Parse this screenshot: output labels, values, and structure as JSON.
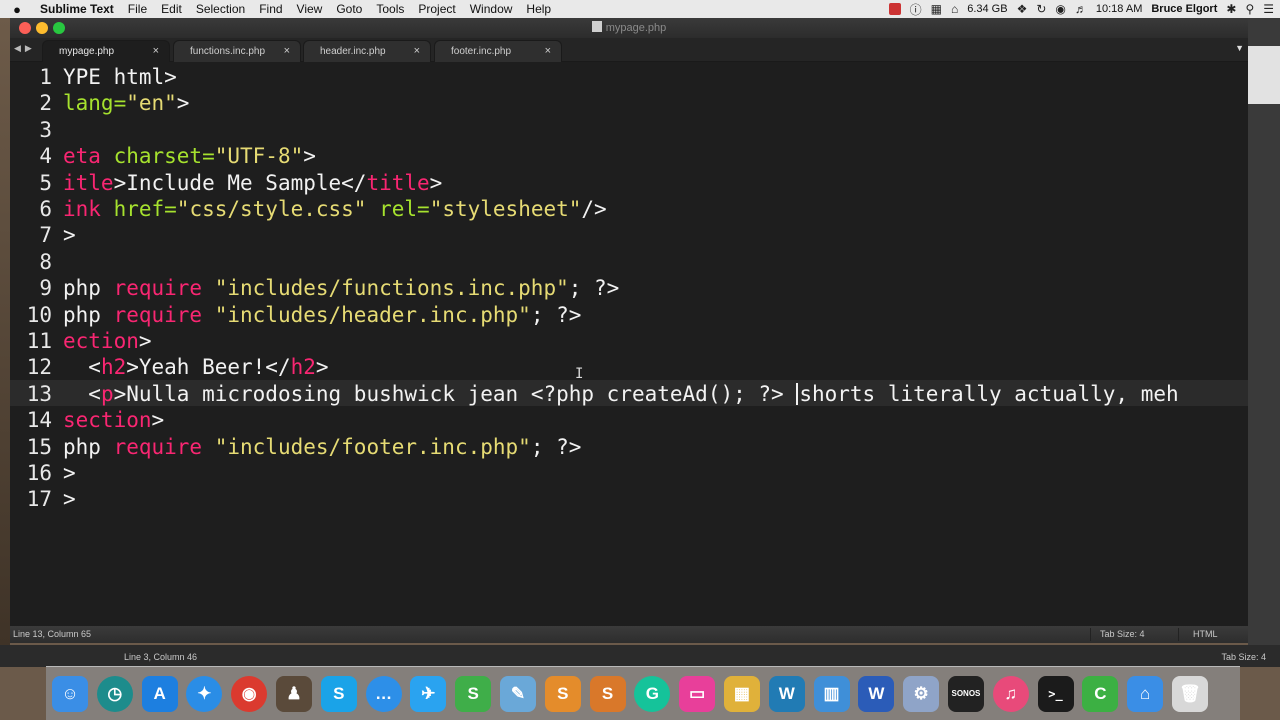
{
  "menubar": {
    "apple": "",
    "app": "Sublime Text",
    "menus": [
      "File",
      "Edit",
      "Selection",
      "Find",
      "View",
      "Goto",
      "Tools",
      "Project",
      "Window",
      "Help"
    ],
    "storage": "6.34 GB",
    "time": "10:18 AM",
    "user": "Bruce Elgort"
  },
  "window": {
    "title": "mypage.php"
  },
  "tabs": [
    {
      "label": "mypage.php",
      "close": "×"
    },
    {
      "label": "functions.inc.php",
      "close": "×"
    },
    {
      "label": "header.inc.php",
      "close": "×"
    },
    {
      "label": "footer.inc.php",
      "close": "×"
    }
  ],
  "editor": {
    "line_numbers": [
      "1",
      "2",
      "3",
      "4",
      "5",
      "6",
      "7",
      "8",
      "9",
      "10",
      "11",
      "12",
      "13",
      "14",
      "15",
      "16",
      "17"
    ],
    "current_line": 13
  },
  "statusbar": {
    "position": "Line 13, Column 65",
    "tab_size": "Tab Size: 4",
    "syntax": "HTML"
  },
  "background_window": {
    "position": "Line 3, Column 46",
    "tab_size": "Tab Size: 4"
  },
  "dock": {
    "apps": [
      {
        "name": "Finder",
        "glyph": "☺",
        "color": "#3a8ee6"
      },
      {
        "name": "Time Machine",
        "glyph": "◷",
        "color": "#1d8c8c"
      },
      {
        "name": "App Store",
        "glyph": "A",
        "color": "#1d7fe0"
      },
      {
        "name": "Safari",
        "glyph": "✦",
        "color": "#2a8de6"
      },
      {
        "name": "Chrome",
        "glyph": "◉",
        "color": "#db3a2f"
      },
      {
        "name": "Agent",
        "glyph": "♟",
        "color": "#5a4a3a"
      },
      {
        "name": "Skype",
        "glyph": "S",
        "color": "#1aa3e8"
      },
      {
        "name": "Messages",
        "glyph": "…",
        "color": "#2d8fe8"
      },
      {
        "name": "Twitter",
        "glyph": "✈",
        "color": "#2aa3f0"
      },
      {
        "name": "Snagit",
        "glyph": "S",
        "color": "#3fae49"
      },
      {
        "name": "Preview",
        "glyph": "✎",
        "color": "#6aa8d8"
      },
      {
        "name": "Sublime Text",
        "glyph": "S",
        "color": "#e48c2b"
      },
      {
        "name": "Sublime Text 2",
        "glyph": "S",
        "color": "#d9782a"
      },
      {
        "name": "Grammarly",
        "glyph": "G",
        "color": "#15c39a"
      },
      {
        "name": "Keynote Pink",
        "glyph": "▭",
        "color": "#e83f9a"
      },
      {
        "name": "Transmit",
        "glyph": "▦",
        "color": "#e0b13a"
      },
      {
        "name": "WordPress",
        "glyph": "W",
        "color": "#217bb4"
      },
      {
        "name": "Screens",
        "glyph": "▥",
        "color": "#3f8fd8"
      },
      {
        "name": "Word",
        "glyph": "W",
        "color": "#2b5cb8"
      },
      {
        "name": "Utility",
        "glyph": "⚙",
        "color": "#8fa4c8"
      },
      {
        "name": "Sonos",
        "glyph": "SONOS",
        "color": "#222222"
      },
      {
        "name": "iTunes",
        "glyph": "♫",
        "color": "#e84a7a"
      },
      {
        "name": "Terminal",
        "glyph": ">_",
        "color": "#1b1b1b"
      },
      {
        "name": "Camtasia",
        "glyph": "C",
        "color": "#3cb043"
      },
      {
        "name": "Keynote",
        "glyph": "⌂",
        "color": "#3a8ee6"
      },
      {
        "name": "Trash",
        "glyph": "🗑",
        "color": "#d8d8d8"
      }
    ]
  }
}
